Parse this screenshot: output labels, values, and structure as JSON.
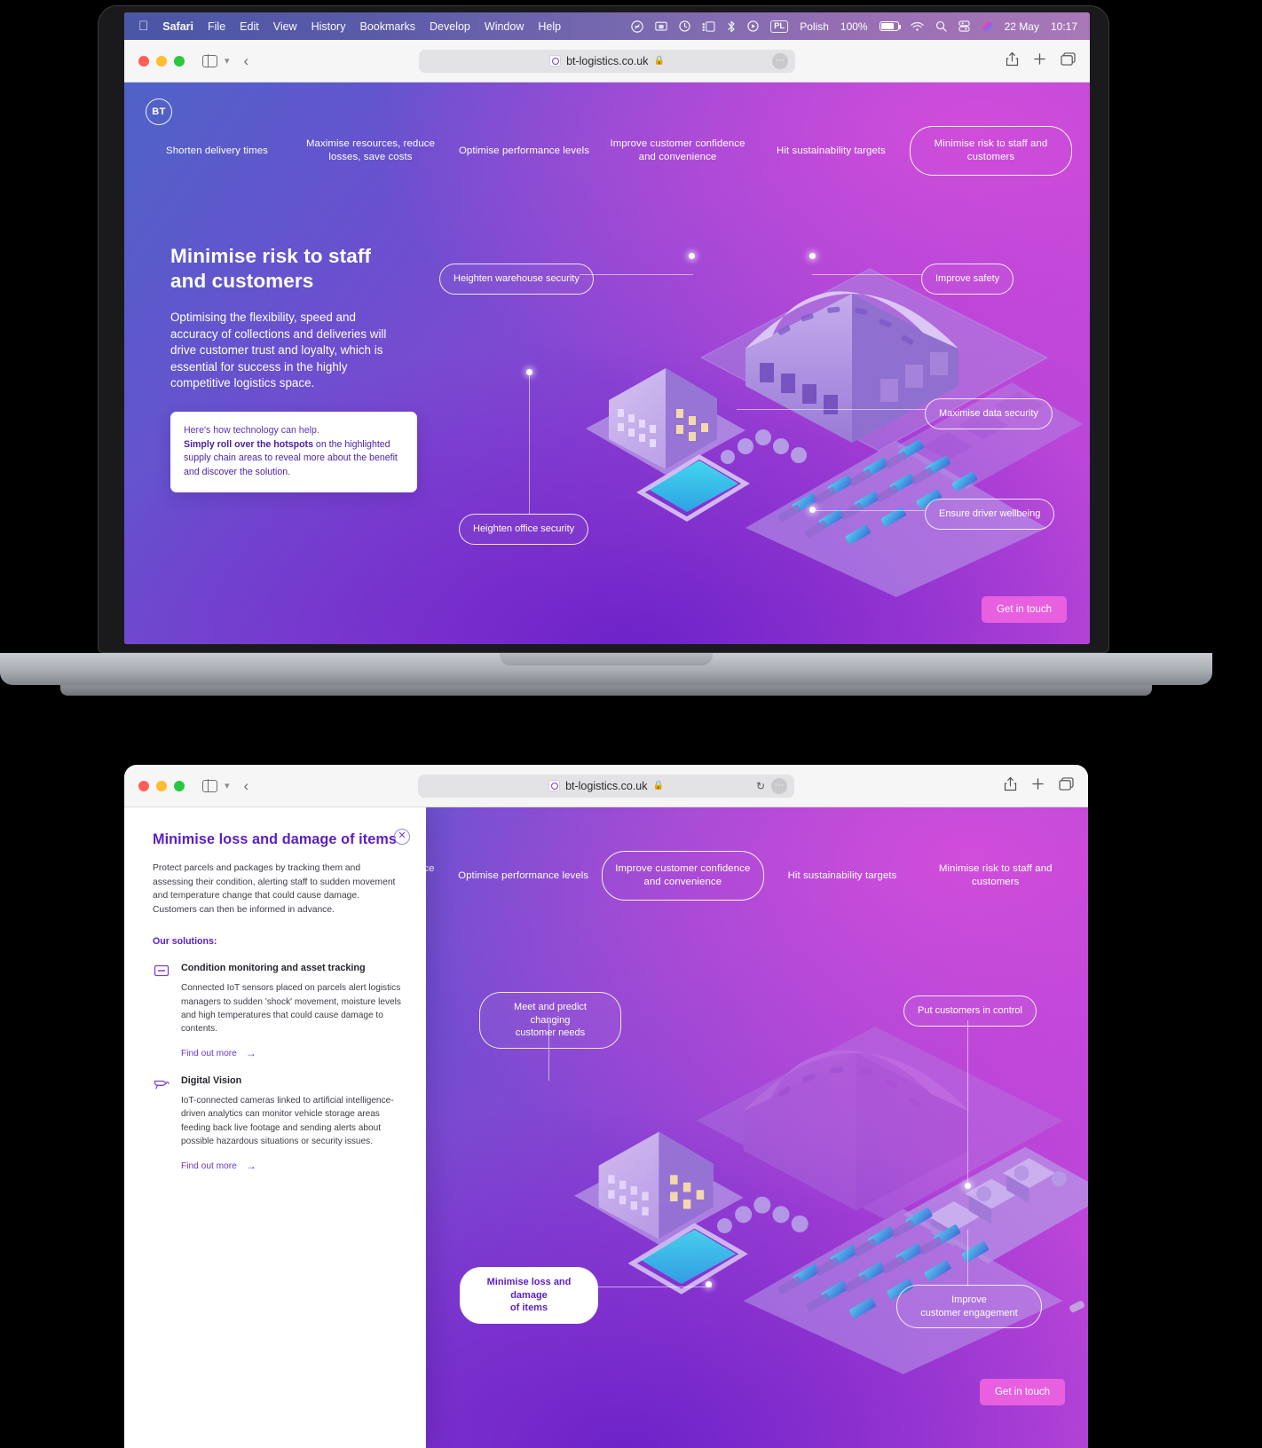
{
  "menubar": {
    "apple_icon": "apple-icon",
    "items": [
      "Safari",
      "File",
      "Edit",
      "View",
      "History",
      "Bookmarks",
      "Develop",
      "Window",
      "Help"
    ],
    "status_icons": [
      "shazam-icon",
      "screen-mirroring-icon",
      "time-machine-icon",
      "stage-manager-icon",
      "bluetooth-icon",
      "now-playing-icon"
    ],
    "input_source_badge": "PL",
    "input_source_label": "Polish",
    "battery_percent": "100%",
    "battery_icon": "battery-charging-icon",
    "wifi_icon": "wifi-icon",
    "search_icon": "spotlight-search-icon",
    "control_center_icon": "control-center-icon",
    "siri_icon": "siri-icon",
    "date": "22 May",
    "time": "10:17"
  },
  "toolbar": {
    "sidebar_icon": "sidebar-toggle-icon",
    "chevron_icon": "chevron-down-icon",
    "back_icon": "back-arrow-icon",
    "url": "bt-logistics.co.uk",
    "favicon": "site-favicon-icon",
    "lock_icon": "lock-icon",
    "reload_icon": "reload-icon",
    "more_icon": "more-dots-icon",
    "share_icon": "share-icon",
    "new_tab_icon": "plus-icon",
    "tabs_icon": "show-tabs-icon"
  },
  "site": {
    "logo_text": "BT",
    "nav": [
      {
        "label": "Shorten delivery times",
        "active_top": false,
        "active_bottom": false
      },
      {
        "label": "Maximise resources, reduce losses, save costs",
        "active_top": false,
        "active_bottom": false
      },
      {
        "label": "Optimise performance levels",
        "active_top": false,
        "active_bottom": false
      },
      {
        "label": "Improve customer confidence and convenience",
        "active_top": false,
        "active_bottom": true
      },
      {
        "label": "Hit sustainability targets",
        "active_top": false,
        "active_bottom": false
      },
      {
        "label": "Minimise risk to staff and customers",
        "active_top": true,
        "active_bottom": false
      }
    ],
    "cta_label": "Get in touch"
  },
  "screen_top": {
    "hero_title_line1": "Minimise risk to staff",
    "hero_title_line2": "and customers",
    "hero_body": "Optimising the flexibility, speed and accuracy of collections and deliveries will drive customer trust and loyalty, which is essential for success in the highly competitive logistics space.",
    "tip_line1": "Here's how technology can help.",
    "tip_bold": "Simply roll over the hotspots",
    "tip_rest": " on the highlighted supply chain areas to reveal more about the benefit and discover the solution.",
    "hotspots": [
      {
        "label": "Heighten warehouse security"
      },
      {
        "label": "Improve safety"
      },
      {
        "label": "Maximise data security"
      },
      {
        "label": "Ensure driver wellbeing"
      },
      {
        "label": "Heighten office security"
      }
    ]
  },
  "screen_bottom": {
    "panel": {
      "title": "Minimise loss and damage of items",
      "close_icon": "close-icon",
      "description": "Protect parcels and packages by tracking them and assessing their condition, alerting staff to sudden movement and temperature change that could cause damage. Customers can then be informed in advance.",
      "solutions_heading": "Our solutions:",
      "solutions": [
        {
          "icon": "asset-tag-icon",
          "title": "Condition monitoring and asset tracking",
          "body": "Connected IoT sensors placed on parcels alert logistics managers to sudden 'shock' movement, moisture levels and high temperatures that could cause damage to contents.",
          "link_label": "Find out more",
          "link_arrow": "→"
        },
        {
          "icon": "cctv-camera-icon",
          "title": "Digital Vision",
          "body": "IoT-connected cameras linked to artificial intelligence-driven analytics can monitor vehicle storage areas feeding back live footage and sending alerts about possible hazardous situations or security issues.",
          "link_label": "Find out more",
          "link_arrow": "→"
        }
      ]
    },
    "hotspots": [
      {
        "label_line1": "Meet and predict changing",
        "label_line2": "customer needs"
      },
      {
        "label_line1": "Put customers in control",
        "label_line2": ""
      },
      {
        "label_line1": "Minimise loss and damage",
        "label_line2": "of items"
      },
      {
        "label_line1": "Improve",
        "label_line2": "customer engagement"
      }
    ]
  },
  "colors": {
    "brand_purple": "#5a1ec6",
    "accent_pink": "#e85fe0",
    "hero_gradient_start": "#4f63c8",
    "hero_gradient_end": "#c44ad9",
    "link_purple": "#6b34cf"
  }
}
